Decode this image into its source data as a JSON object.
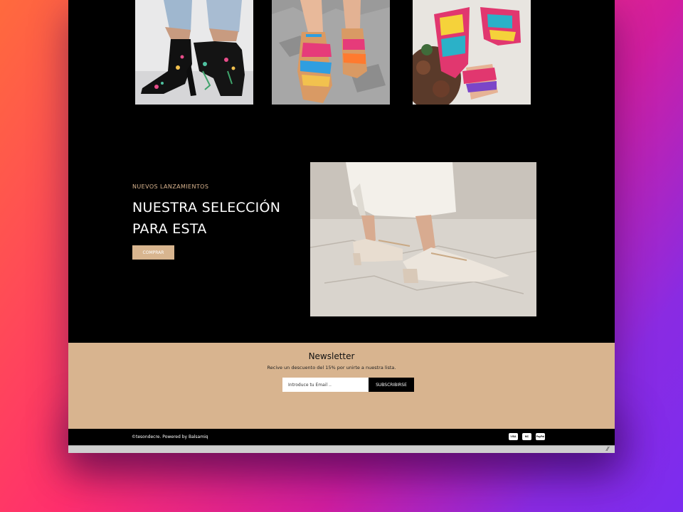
{
  "hero": {
    "eyebrow": "NUEVOS LANZAMIENTOS",
    "headline_line1": "NUESTRA SELECCIÓN",
    "headline_line2": "PARA ESTA",
    "button_label": "COMPRAR"
  },
  "newsletter": {
    "title": "Newsletter",
    "subtitle": "Recive un descuento del 15% por unirte a nuestra lista.",
    "email_placeholder": "Introduce tu Email ..",
    "subscribe_label": "SUBSCRIBIRSE"
  },
  "footer": {
    "copyright": "©tesondecre. Powered by Balsamiq",
    "payments": [
      "VISA",
      "MC",
      "PayPal"
    ]
  },
  "colors": {
    "accent": "#d8b48f",
    "page_bg": "#000000",
    "background_gradient": [
      "#ff6a3d",
      "#ff2f6d",
      "#d21e9f",
      "#7b2cf0"
    ]
  },
  "gallery": {
    "images": [
      "black-embroidered-heels-photo",
      "colorful-woven-sandals-photo",
      "pink-woven-sandals-photo"
    ]
  }
}
